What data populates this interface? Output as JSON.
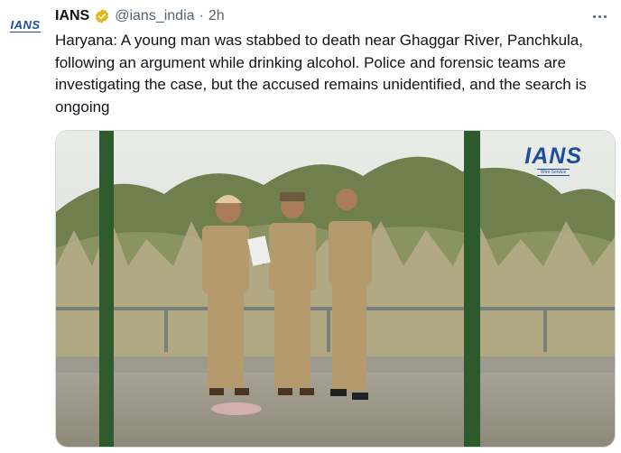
{
  "tweet": {
    "author_name": "IANS",
    "handle": "@ians_india",
    "separator": "·",
    "time": "2h",
    "verified_badge_icon": "gold-verified-badge-icon",
    "body": "Haryana: A young man was stabbed to death near Ghaggar River, Panchkula, following an argument while drinking alcohol. Police and forensic teams are investigating the case, but the accused remains unidentified, and the search is ongoing"
  },
  "avatar": {
    "logo_text": "IANS"
  },
  "media": {
    "watermark_text": "IANS",
    "watermark_sub": "Wire Service"
  },
  "colors": {
    "brand_blue": "#1d4d9c",
    "verified_gold": "#e2b719",
    "secondary_text": "#536471"
  },
  "icons": {
    "more": "more-options-icon"
  }
}
